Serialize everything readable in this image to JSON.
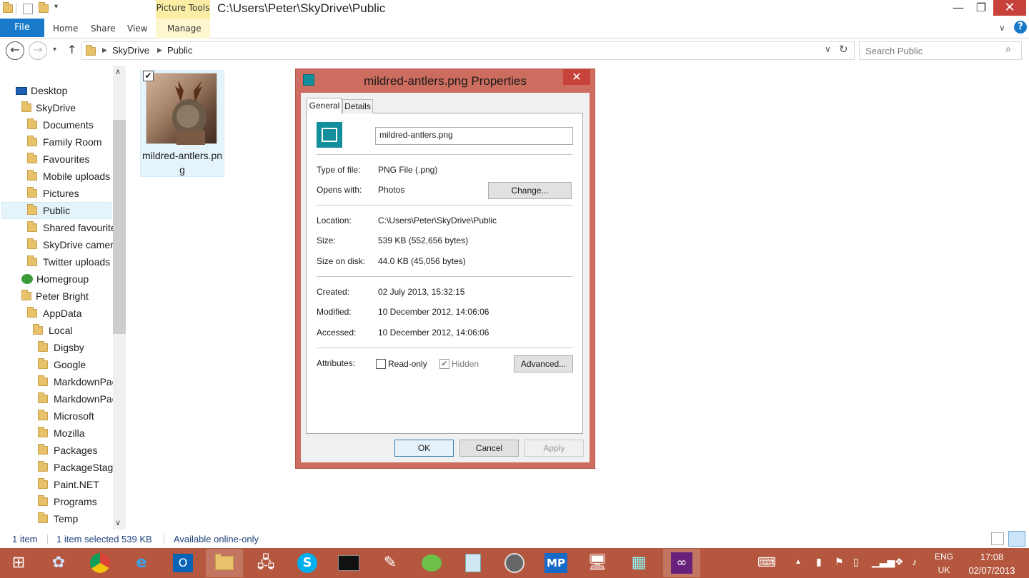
{
  "titlebar": {
    "context_tab": "Picture Tools",
    "path_title": "C:\\Users\\Peter\\SkyDrive\\Public",
    "minimize": "—",
    "maximize": "❐",
    "close": "✕"
  },
  "ribbon": {
    "file": "File",
    "tabs": [
      "Home",
      "Share",
      "View",
      "Manage"
    ],
    "help": "?"
  },
  "address": {
    "back": "←",
    "forward": "→",
    "up": "↑",
    "crumbs": [
      "SkyDrive",
      "Public"
    ],
    "search_placeholder": "Search Public"
  },
  "navpane": {
    "items": [
      {
        "label": "Desktop",
        "icon": "desktop-icon"
      },
      {
        "label": "SkyDrive",
        "icon": "skydrive-folder-icon"
      },
      {
        "label": "Documents",
        "icon": "folder-icon"
      },
      {
        "label": "Family Room",
        "icon": "folder-icon"
      },
      {
        "label": "Favourites",
        "icon": "folder-icon"
      },
      {
        "label": "Mobile uploads",
        "icon": "folder-icon"
      },
      {
        "label": "Pictures",
        "icon": "folder-icon"
      },
      {
        "label": "Public",
        "icon": "folder-icon"
      },
      {
        "label": "Shared favourite",
        "icon": "folder-icon"
      },
      {
        "label": "SkyDrive camera",
        "icon": "folder-icon"
      },
      {
        "label": "Twitter uploads",
        "icon": "folder-icon"
      },
      {
        "label": "Homegroup",
        "icon": "homegroup-icon"
      },
      {
        "label": "Peter Bright",
        "icon": "user-folder-icon"
      },
      {
        "label": "AppData",
        "icon": "folder-icon"
      },
      {
        "label": "Local",
        "icon": "folder-icon"
      },
      {
        "label": "Digsby",
        "icon": "folder-icon"
      },
      {
        "label": "Google",
        "icon": "folder-icon"
      },
      {
        "label": "MarkdownPac",
        "icon": "folder-icon"
      },
      {
        "label": "MarkdownPac",
        "icon": "folder-icon"
      },
      {
        "label": "Microsoft",
        "icon": "folder-icon"
      },
      {
        "label": "Mozilla",
        "icon": "folder-icon"
      },
      {
        "label": "Packages",
        "icon": "folder-icon"
      },
      {
        "label": "PackageStagin",
        "icon": "folder-icon"
      },
      {
        "label": "Paint.NET",
        "icon": "folder-icon"
      },
      {
        "label": "Programs",
        "icon": "folder-icon"
      },
      {
        "label": "Temp",
        "icon": "folder-icon"
      }
    ]
  },
  "file_item": {
    "name": "mildred-antlers.png",
    "checked": "✔"
  },
  "dialog": {
    "title": "mildred-antlers.png Properties",
    "close": "✕",
    "tabs": [
      "General",
      "Details"
    ],
    "file_name_value": "mildred-antlers.png",
    "type_label": "Type of file:",
    "type_value": "PNG File (.png)",
    "opens_label": "Opens with:",
    "opens_value": "Photos",
    "change_button": "Change...",
    "location_label": "Location:",
    "location_value": "C:\\Users\\Peter\\SkyDrive\\Public",
    "size_label": "Size:",
    "size_value": "539 KB (552,656 bytes)",
    "size_disk_label": "Size on disk:",
    "size_disk_value": "44.0 KB (45,056 bytes)",
    "created_label": "Created:",
    "created_value": "02 July 2013, 15:32:15",
    "modified_label": "Modified:",
    "modified_value": "10 December 2012, 14:06:06",
    "accessed_label": "Accessed:",
    "accessed_value": "10 December 2012, 14:06:06",
    "attributes_label": "Attributes:",
    "readonly_label": "Read-only",
    "hidden_label": "Hidden",
    "hidden_check": "✔",
    "advanced_button": "Advanced...",
    "ok_button": "OK",
    "cancel_button": "Cancel",
    "apply_button": "Apply"
  },
  "statusbar": {
    "count": "1 item",
    "selected": "1 item selected  539 KB",
    "availability": "Available online-only"
  },
  "taskbar": {
    "apps": [
      "start",
      "file-explorer-pin",
      "chrome",
      "internet-explorer",
      "outlook",
      "file-explorer",
      "remote-desktop",
      "skype",
      "command-prompt",
      "paint-app",
      "frog-app",
      "notepad-app",
      "media-app",
      "markdownpad",
      "remote-connection",
      "grid-app",
      "visual-studio"
    ],
    "language": "ENG",
    "region": "UK",
    "time": "17:08",
    "date": "02/07/2013"
  },
  "colors": {
    "accent": "#1979ca",
    "taskbar": "#b5573f",
    "dialog_frame": "#cc6d5f",
    "close_red": "#c7423a"
  }
}
